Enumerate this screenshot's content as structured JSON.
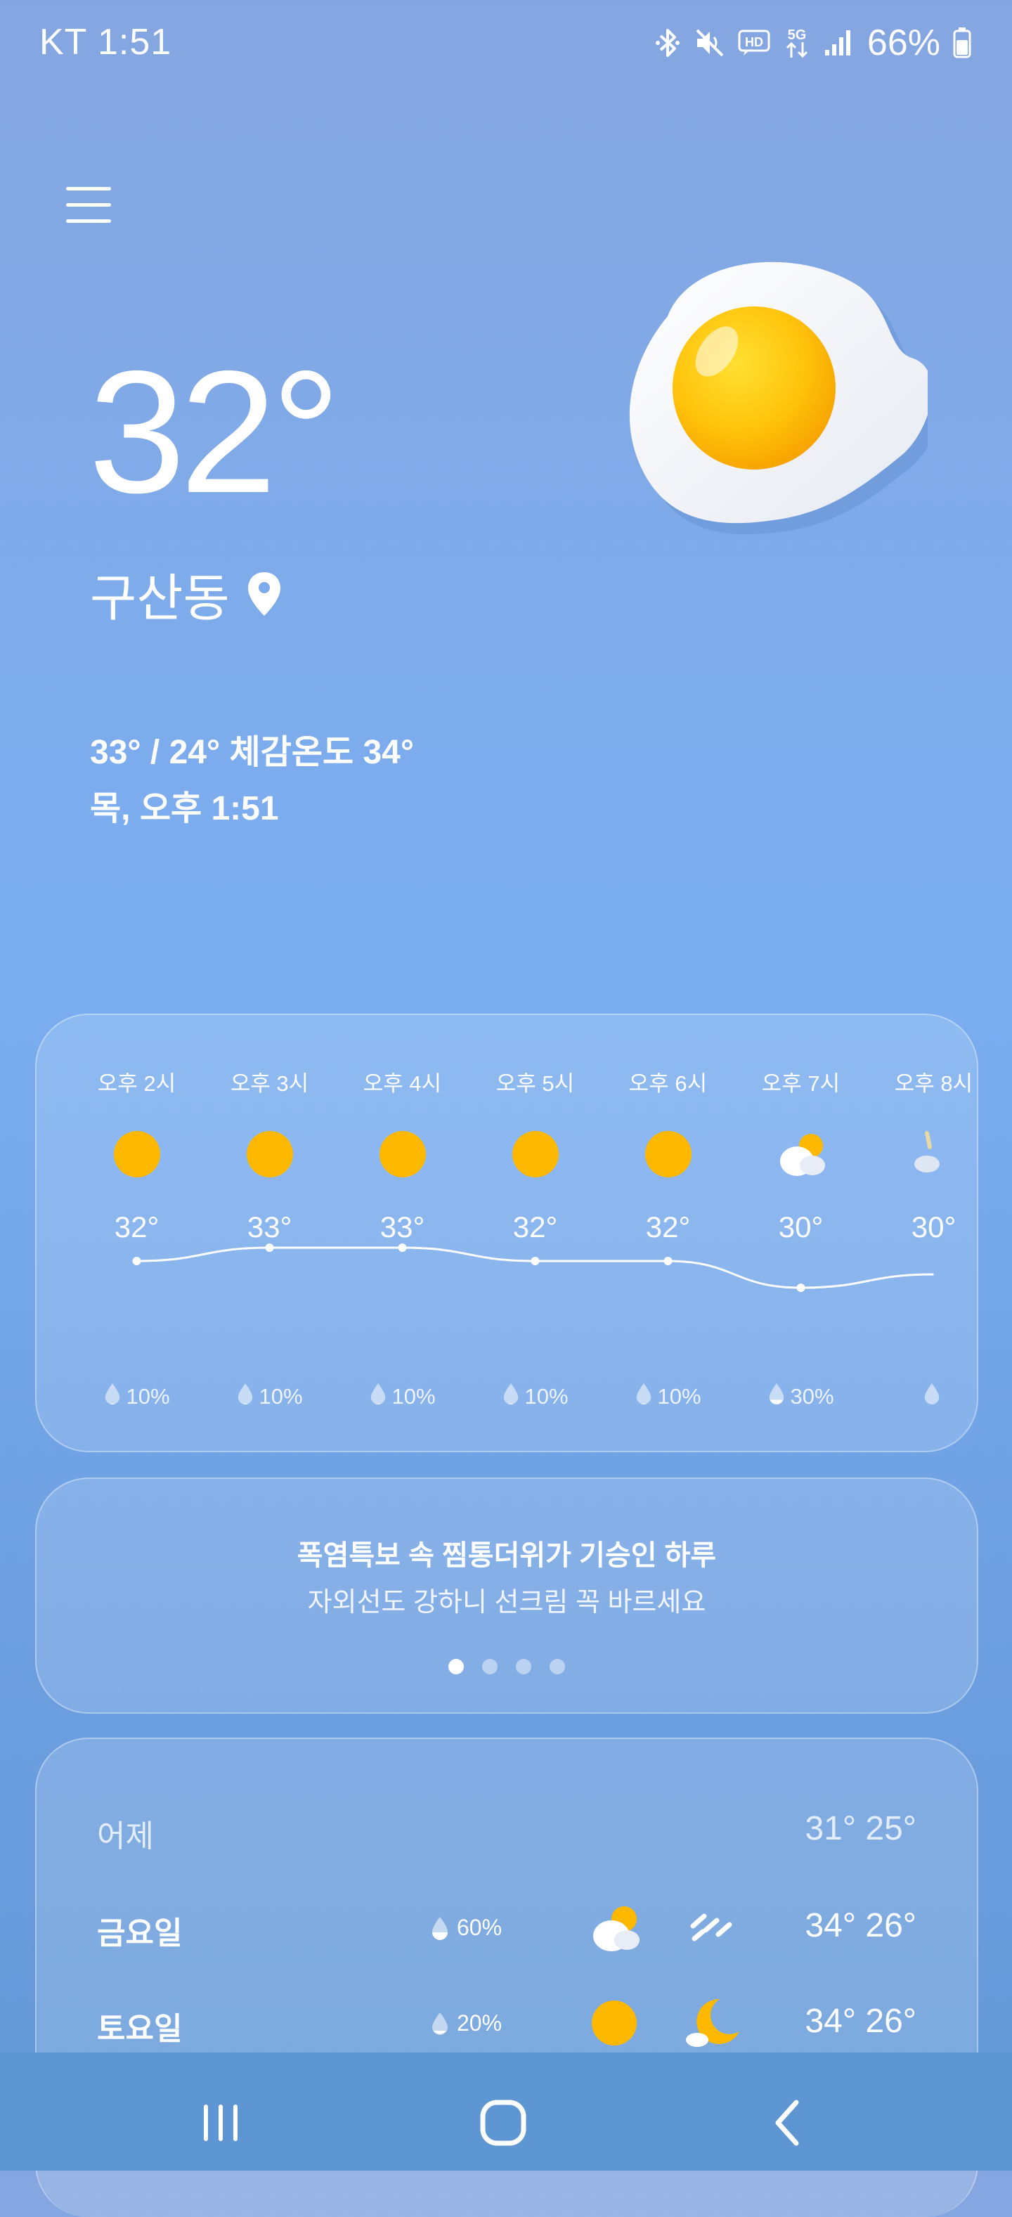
{
  "status_bar": {
    "carrier_time": "KT 1:51",
    "battery": "66%",
    "icons": [
      "bluetooth-icon",
      "mute-icon",
      "hd-voice-icon",
      "5g-icon",
      "signal-icon",
      "battery-icon"
    ]
  },
  "current": {
    "temperature": "32°",
    "location": "구산동",
    "high_low_feels": "33° / 24° 체감온도 34°",
    "datetime": "목, 오후 1:51",
    "condition_icon": "sunny-egg-icon"
  },
  "hourly": [
    {
      "time": "오후 2시",
      "icon": "sun-icon",
      "temp": "32°",
      "precip": "10%",
      "temp_value": 32
    },
    {
      "time": "오후 3시",
      "icon": "sun-icon",
      "temp": "33°",
      "precip": "10%",
      "temp_value": 33
    },
    {
      "time": "오후 4시",
      "icon": "sun-icon",
      "temp": "33°",
      "precip": "10%",
      "temp_value": 33
    },
    {
      "time": "오후 5시",
      "icon": "sun-icon",
      "temp": "32°",
      "precip": "10%",
      "temp_value": 32
    },
    {
      "time": "오후 6시",
      "icon": "sun-icon",
      "temp": "32°",
      "precip": "10%",
      "temp_value": 32
    },
    {
      "time": "오후 7시",
      "icon": "partly-cloudy-icon",
      "temp": "30°",
      "precip": "30%",
      "temp_value": 30
    },
    {
      "time": "오후 8시",
      "icon": "cloudy-night-icon",
      "temp": "30°",
      "precip": "",
      "temp_value": 31
    }
  ],
  "alert": {
    "title": "폭염특보 속 찜통더위가 기승인 하루",
    "subtitle": "자외선도 강하니 선크림 꼭 바르세요",
    "pages": 4,
    "active_page": 0
  },
  "daily": [
    {
      "day": "어제",
      "precip": "",
      "icon_day": "",
      "icon_night": "",
      "temps": "31° 25°"
    },
    {
      "day": "금요일",
      "precip": "60%",
      "icon_day": "partly-cloudy-icon",
      "icon_night": "rain-icon",
      "temps": "34° 26°"
    },
    {
      "day": "토요일",
      "precip": "20%",
      "icon_day": "sun-icon",
      "icon_night": "moon-cloud-icon",
      "temps": "34° 26°"
    }
  ],
  "nav": {
    "icons": [
      "recent-apps-icon",
      "home-icon",
      "back-icon"
    ]
  },
  "colors": {
    "sun": "#FFB800",
    "card_fill": "rgba(255,255,255,0.16)",
    "nav": "#5e95d3"
  }
}
